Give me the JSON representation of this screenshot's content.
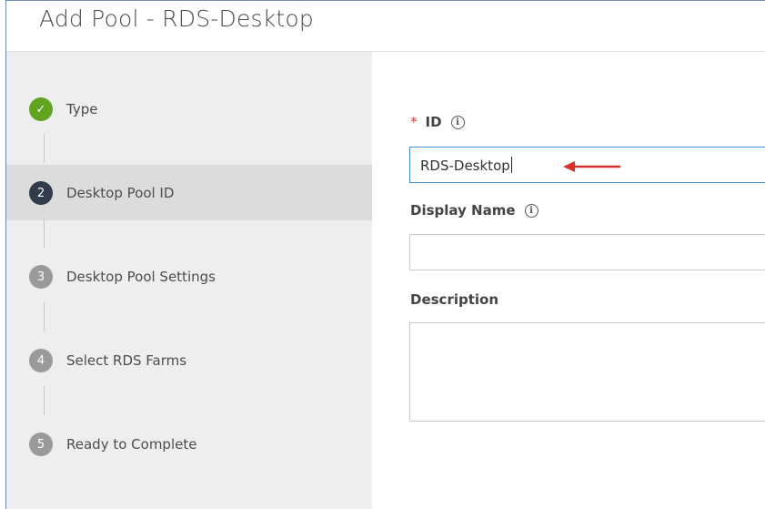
{
  "window": {
    "title": "Add Pool - RDS-Desktop"
  },
  "wizard": {
    "steps": [
      {
        "number": "✓",
        "label": "Type",
        "state": "done"
      },
      {
        "number": "2",
        "label": "Desktop Pool ID",
        "state": "current"
      },
      {
        "number": "3",
        "label": "Desktop Pool Settings",
        "state": "pending"
      },
      {
        "number": "4",
        "label": "Select RDS Farms",
        "state": "pending"
      },
      {
        "number": "5",
        "label": "Ready to Complete",
        "state": "pending"
      }
    ]
  },
  "form": {
    "id": {
      "required_marker": "*",
      "label": "ID",
      "info_icon": "info-icon",
      "value": "RDS-Desktop"
    },
    "display_name": {
      "label": "Display Name",
      "info_icon": "info-icon",
      "value": ""
    },
    "description": {
      "label": "Description",
      "value": ""
    }
  },
  "annotation": {
    "arrow_color": "#d9302c",
    "icon": "red-arrow-left-icon"
  },
  "colors": {
    "step_done": "#62a420",
    "step_current": "#313c4b",
    "step_pending": "#9a9a9a",
    "focus_border": "#4a90d0",
    "required": "#d23c3c"
  }
}
